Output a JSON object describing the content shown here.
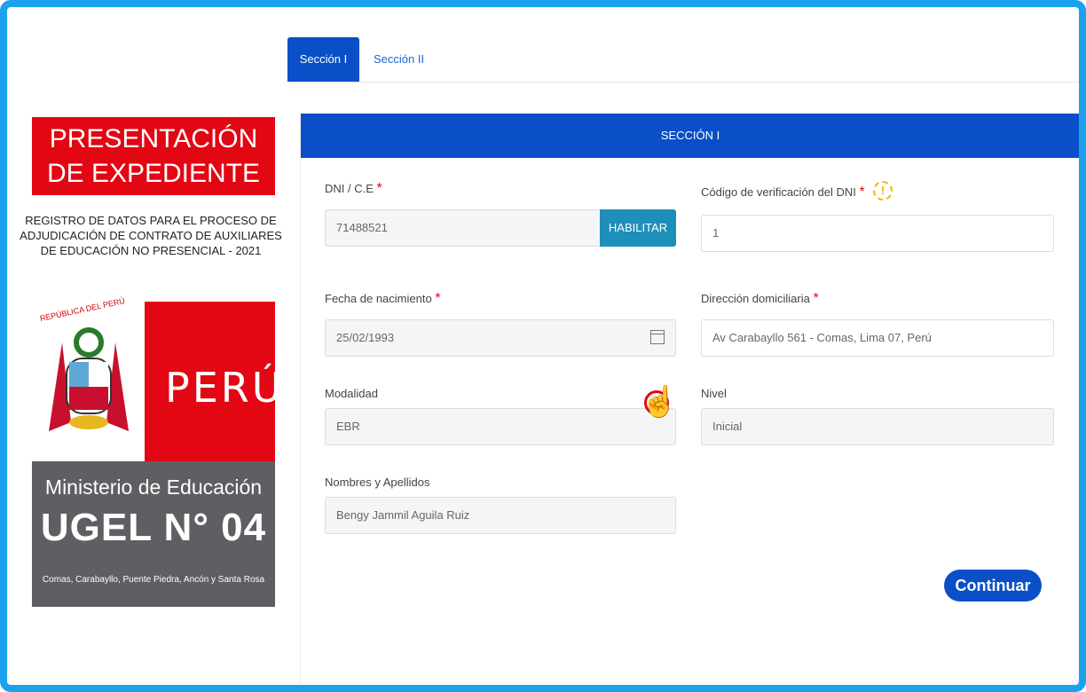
{
  "tabs": {
    "tab1": "Sección I",
    "tab2": "Sección II"
  },
  "left": {
    "title": "PRESENTACIÓN DE EXPEDIENTE",
    "subtitle": "REGISTRO DE DATOS PARA EL PROCESO DE ADJUDICACIÓN DE CONTRATO DE AUXILIARES DE EDUCACIÓN NO PRESENCIAL - 2021",
    "republica": "REPÚBLICA DEL PERÚ",
    "peru": "PERÚ",
    "ministerio": "Ministerio de Educación",
    "ugel": "UGEL N° 04",
    "districts": "Comas, Carabayllo, Puente Piedra, Ancón y Santa Rosa"
  },
  "form": {
    "section_title": "SECCIÓN I",
    "dni_label": "DNI / C.E",
    "dni_value": "71488521",
    "habilitar": "HABILITAR",
    "codigo_label": "Código de verificación del DNI",
    "codigo_value": "1",
    "warn_icon": "!",
    "fecha_label": "Fecha de nacimiento",
    "fecha_value": "25/02/1993",
    "direccion_label": "Dirección domiciliaria",
    "direccion_value": "Av Carabayllo 561 - Comas, Lima 07, Perú",
    "modalidad_label": "Modalidad",
    "modalidad_value": "EBR",
    "nivel_label": "Nivel",
    "nivel_value": "Inicial",
    "nombres_label": "Nombres y Apellidos",
    "nombres_value": "Bengy Jammil Aguila Ruiz",
    "required_mark": "*",
    "continuar": "Continuar"
  },
  "colors": {
    "primary": "#0a4fc7",
    "accent_red": "#e30613",
    "frame": "#1aa3ec",
    "teal": "#1e8fb9"
  },
  "icons": {
    "calendar": "calendar-icon",
    "warning": "warning-icon",
    "hand": "hand-pointer-icon"
  }
}
